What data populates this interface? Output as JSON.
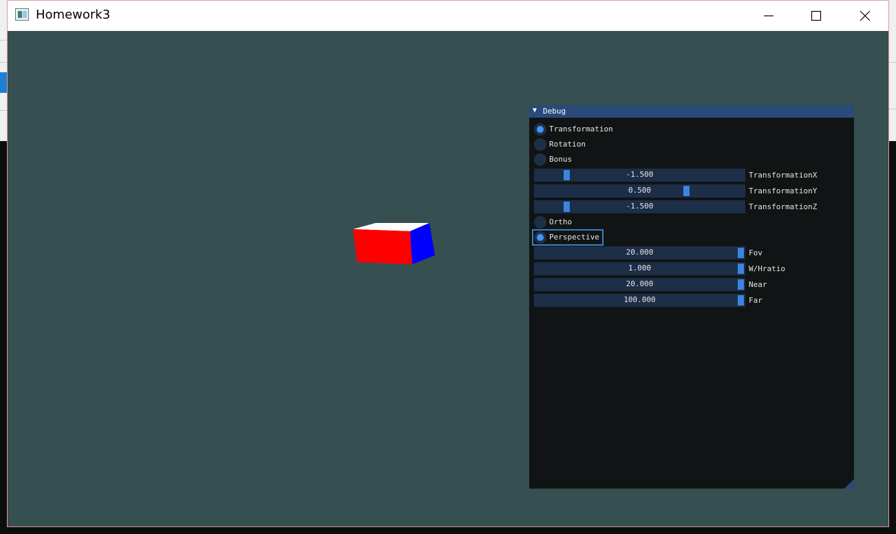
{
  "window": {
    "title": "Homework3",
    "controls": {
      "minimize_icon": "minimize-icon",
      "maximize_icon": "maximize-icon",
      "close_icon": "close-icon"
    }
  },
  "viewport": {
    "background": "#364f50",
    "cube_colors": {
      "front": "#ff0000",
      "side": "#0000ff",
      "top": "#ffffff"
    }
  },
  "debug": {
    "title": "Debug",
    "collapse_icon": "triangle-down-icon",
    "mode_radios": [
      {
        "label": "Transformation",
        "selected": true
      },
      {
        "label": "Rotation",
        "selected": false
      },
      {
        "label": "Bonus",
        "selected": false
      }
    ],
    "transform_sliders": [
      {
        "label": "TransformationX",
        "value": "-1.500",
        "fraction": 0.14
      },
      {
        "label": "TransformationY",
        "value": "0.500",
        "fraction": 0.73
      },
      {
        "label": "TransformationZ",
        "value": "-1.500",
        "fraction": 0.14
      }
    ],
    "projection_radios": [
      {
        "label": "Ortho",
        "selected": false
      },
      {
        "label": "Perspective",
        "selected": true,
        "focused": true
      }
    ],
    "projection_sliders": [
      {
        "label": "Fov",
        "value": "20.000",
        "fraction": 1.0
      },
      {
        "label": "W/Hratio",
        "value": "1.000",
        "fraction": 1.0
      },
      {
        "label": "Near",
        "value": "20.000",
        "fraction": 1.0
      },
      {
        "label": "Far",
        "value": "100.000",
        "fraction": 1.0
      }
    ],
    "colors": {
      "header": "#294a7a",
      "panel": "#111414",
      "frame": "#1d2e48",
      "accent": "#4296f9"
    }
  }
}
